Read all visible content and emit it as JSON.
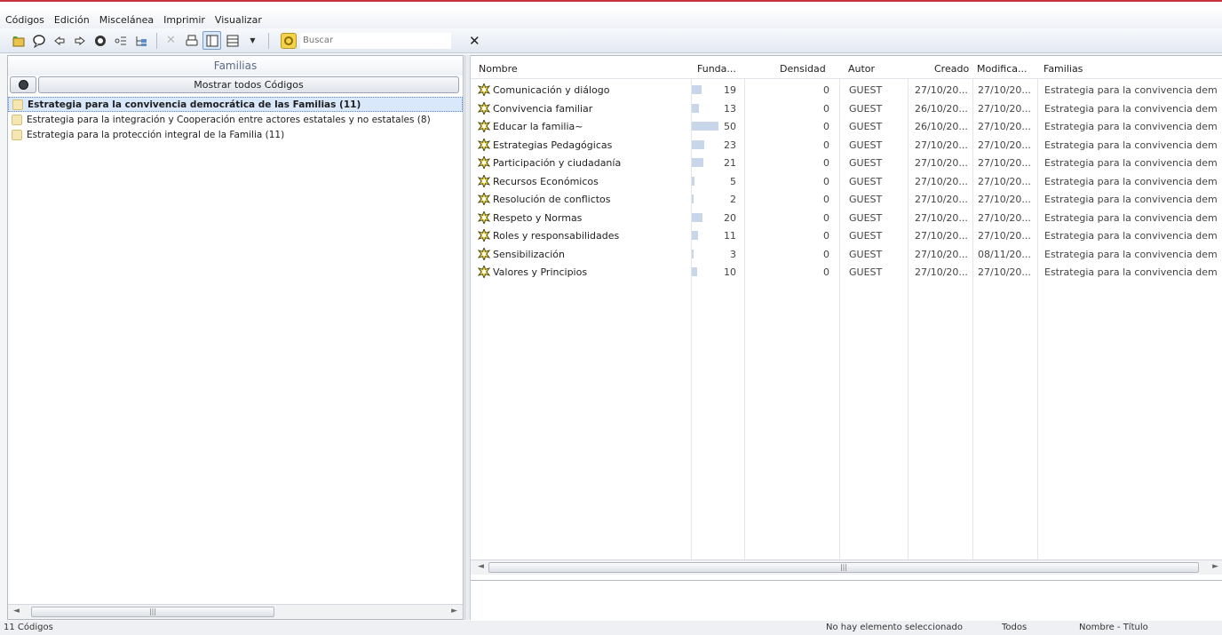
{
  "menu": [
    "Códigos",
    "Edición",
    "Miscelánea",
    "Imprimir",
    "Visualizar"
  ],
  "search": {
    "placeholder": "Buscar"
  },
  "left_panel": {
    "title": "Familias",
    "show_all_label": "Mostrar todos Códigos",
    "families": [
      {
        "label": "Estrategia para la convivencia democrática de las Familias (11)",
        "selected": true
      },
      {
        "label": "Estrategia para la integración y Cooperación entre actores estatales y no estatales (8)",
        "selected": false
      },
      {
        "label": "Estrategia para la protección integral de la Familia (11)",
        "selected": false
      }
    ]
  },
  "table": {
    "columns": [
      "Nombre",
      "Funda...",
      "Densidad",
      "Autor",
      "Creado",
      "Modifica...",
      "Familias"
    ],
    "rows": [
      {
        "name": "Comunicación y diálogo",
        "grounded": "19",
        "density": "0",
        "author": "GUEST",
        "created": "27/10/20...",
        "modified": "27/10/20...",
        "families": "Estrategia para la convivencia dem"
      },
      {
        "name": "Convivencia familiar",
        "grounded": "13",
        "density": "0",
        "author": "GUEST",
        "created": "26/10/20...",
        "modified": "27/10/20...",
        "families": "Estrategia para la convivencia dem"
      },
      {
        "name": "Educar la familia~",
        "grounded": "50",
        "density": "0",
        "author": "GUEST",
        "created": "26/10/20...",
        "modified": "27/10/20...",
        "families": "Estrategia para la convivencia dem"
      },
      {
        "name": "Estrategias Pedagógicas",
        "grounded": "23",
        "density": "0",
        "author": "GUEST",
        "created": "27/10/20...",
        "modified": "27/10/20...",
        "families": "Estrategia para la convivencia dem"
      },
      {
        "name": "Participación y ciudadanía",
        "grounded": "21",
        "density": "0",
        "author": "GUEST",
        "created": "27/10/20...",
        "modified": "27/10/20...",
        "families": "Estrategia para la convivencia dem"
      },
      {
        "name": "Recursos Económicos",
        "grounded": "5",
        "density": "0",
        "author": "GUEST",
        "created": "27/10/20...",
        "modified": "27/10/20...",
        "families": "Estrategia para la convivencia dem"
      },
      {
        "name": "Resolución de conflictos",
        "grounded": "2",
        "density": "0",
        "author": "GUEST",
        "created": "27/10/20...",
        "modified": "27/10/20...",
        "families": "Estrategia para la convivencia dem"
      },
      {
        "name": "Respeto y Normas",
        "grounded": "20",
        "density": "0",
        "author": "GUEST",
        "created": "27/10/20...",
        "modified": "27/10/20...",
        "families": "Estrategia para la convivencia dem"
      },
      {
        "name": "Roles y responsabilidades",
        "grounded": "11",
        "density": "0",
        "author": "GUEST",
        "created": "27/10/20...",
        "modified": "27/10/20...",
        "families": "Estrategia para la convivencia dem"
      },
      {
        "name": "Sensibilización",
        "grounded": "3",
        "density": "0",
        "author": "GUEST",
        "created": "27/10/20...",
        "modified": "08/11/20...",
        "families": "Estrategia para la convivencia dem"
      },
      {
        "name": "Valores y Principios",
        "grounded": "10",
        "density": "0",
        "author": "GUEST",
        "created": "27/10/20...",
        "modified": "27/10/20...",
        "families": "Estrategia para la convivencia dem"
      }
    ]
  },
  "status": {
    "count": "11 Códigos",
    "selection": "No hay elemento seleccionado",
    "filter": "Todos",
    "sort": "Nombre - Título"
  }
}
